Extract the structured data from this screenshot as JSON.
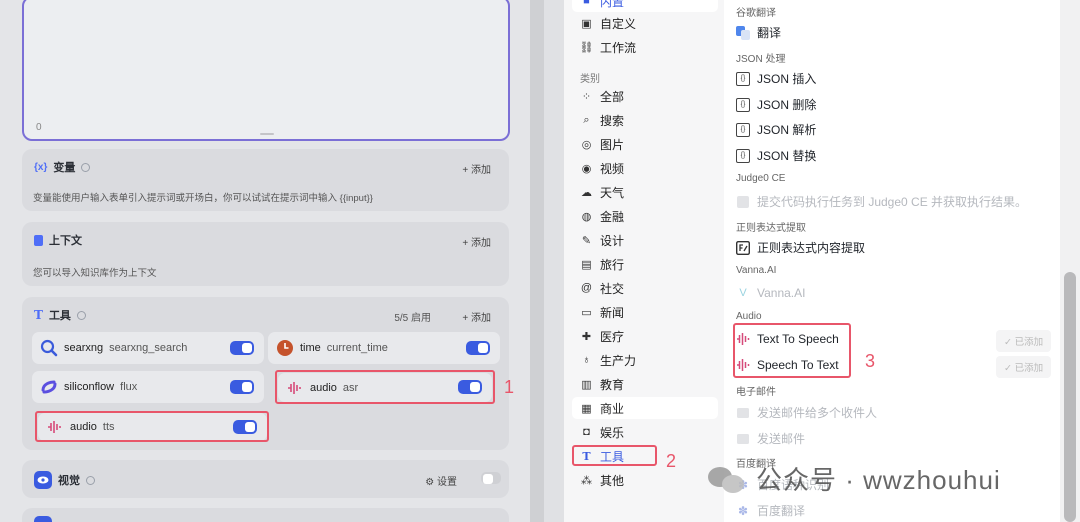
{
  "left": {
    "editor_count": "0",
    "variables": {
      "title": "变量",
      "add": "+ 添加",
      "desc": "变量能使用户输入表单引入提示词或开场白，你可以试试在提示词中输入 {{input}}"
    },
    "context": {
      "title": "上下文",
      "add": "+ 添加",
      "desc": "您可以导入知识库作为上下文"
    },
    "tools": {
      "title": "工具",
      "count": "5/5 启用",
      "add": "+ 添加",
      "items": [
        {
          "name": "searxng",
          "sub": "searxng_search",
          "icon": "search-icon"
        },
        {
          "name": "time",
          "sub": "current_time",
          "icon": "clock-icon"
        },
        {
          "name": "siliconflow",
          "sub": "flux",
          "icon": "siliconflow-icon"
        },
        {
          "name": "audio",
          "sub": "asr",
          "icon": "audio-icon"
        },
        {
          "name": "audio",
          "sub": "tts",
          "icon": "audio-icon"
        }
      ]
    },
    "vision": {
      "title": "视觉",
      "setting": "设置"
    },
    "markers": [
      "1",
      "2",
      "3"
    ]
  },
  "sidebar": {
    "top_items": [
      {
        "label": "内置"
      },
      {
        "label": "自定义"
      },
      {
        "label": "工作流"
      }
    ],
    "category_title": "类别",
    "categories": [
      {
        "label": "全部"
      },
      {
        "label": "搜索"
      },
      {
        "label": "图片"
      },
      {
        "label": "视频"
      },
      {
        "label": "天气"
      },
      {
        "label": "金融"
      },
      {
        "label": "设计"
      },
      {
        "label": "旅行"
      },
      {
        "label": "社交"
      },
      {
        "label": "新闻"
      },
      {
        "label": "医疗"
      },
      {
        "label": "生产力"
      },
      {
        "label": "教育"
      },
      {
        "label": "商业"
      },
      {
        "label": "娱乐"
      },
      {
        "label": "工具"
      },
      {
        "label": "其他"
      }
    ]
  },
  "content": {
    "google": {
      "group": "谷歌翻译",
      "items": [
        "翻译"
      ]
    },
    "json": {
      "group": "JSON 处理",
      "items": [
        "JSON 插入",
        "JSON 删除",
        "JSON 解析",
        "JSON 替换"
      ]
    },
    "judge0": {
      "group": "Judge0 CE",
      "items": [
        "提交代码执行任务到 Judge0 CE 并获取执行结果。"
      ]
    },
    "regex": {
      "group": "正则表达式提取",
      "items": [
        "正则表达式内容提取"
      ]
    },
    "vanna": {
      "group": "Vanna.AI",
      "items": [
        "Vanna.AI"
      ]
    },
    "audio": {
      "group": "Audio",
      "items": [
        "Text To Speech",
        "Speech To Text"
      ],
      "added": "✓ 已添加"
    },
    "email": {
      "group": "电子邮件",
      "items": [
        "发送邮件给多个收件人",
        "发送邮件"
      ]
    },
    "baidu": {
      "group": "百度翻译",
      "items": [
        "百度语种识别",
        "百度翻译"
      ]
    }
  },
  "watermark": {
    "text": "公众号 · wwzhouhui"
  }
}
